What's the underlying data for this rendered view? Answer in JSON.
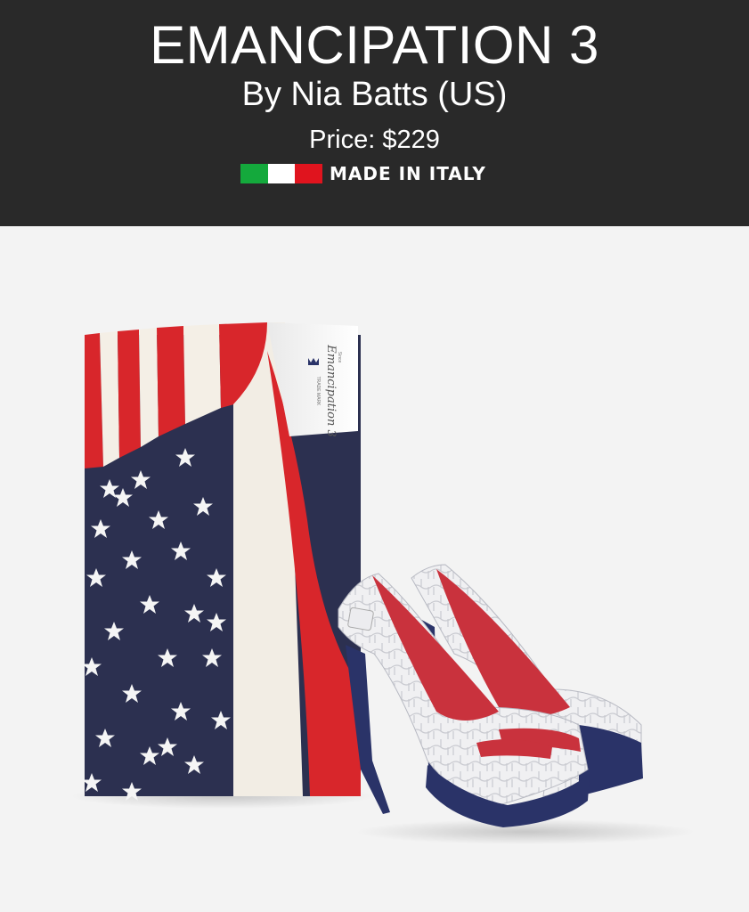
{
  "header": {
    "title": "EMANCIPATION 3",
    "byline": "By Nia Batts (US)",
    "price": "Price: $229",
    "made_in": "MADE IN ITALY",
    "flag_colors": [
      "#14a93c",
      "#ffffff",
      "#e0141e"
    ],
    "background": "#292929"
  },
  "product": {
    "box_label": "Emancipation 3",
    "box_label_small": "TRADE MARK",
    "box_label_since": "Since",
    "colors": {
      "flag_blue": "#2c3050",
      "flag_red": "#d8262b",
      "shoe_white": "#f0f0f2",
      "shoe_red": "#c9323d",
      "shoe_blue": "#2a3368"
    }
  }
}
